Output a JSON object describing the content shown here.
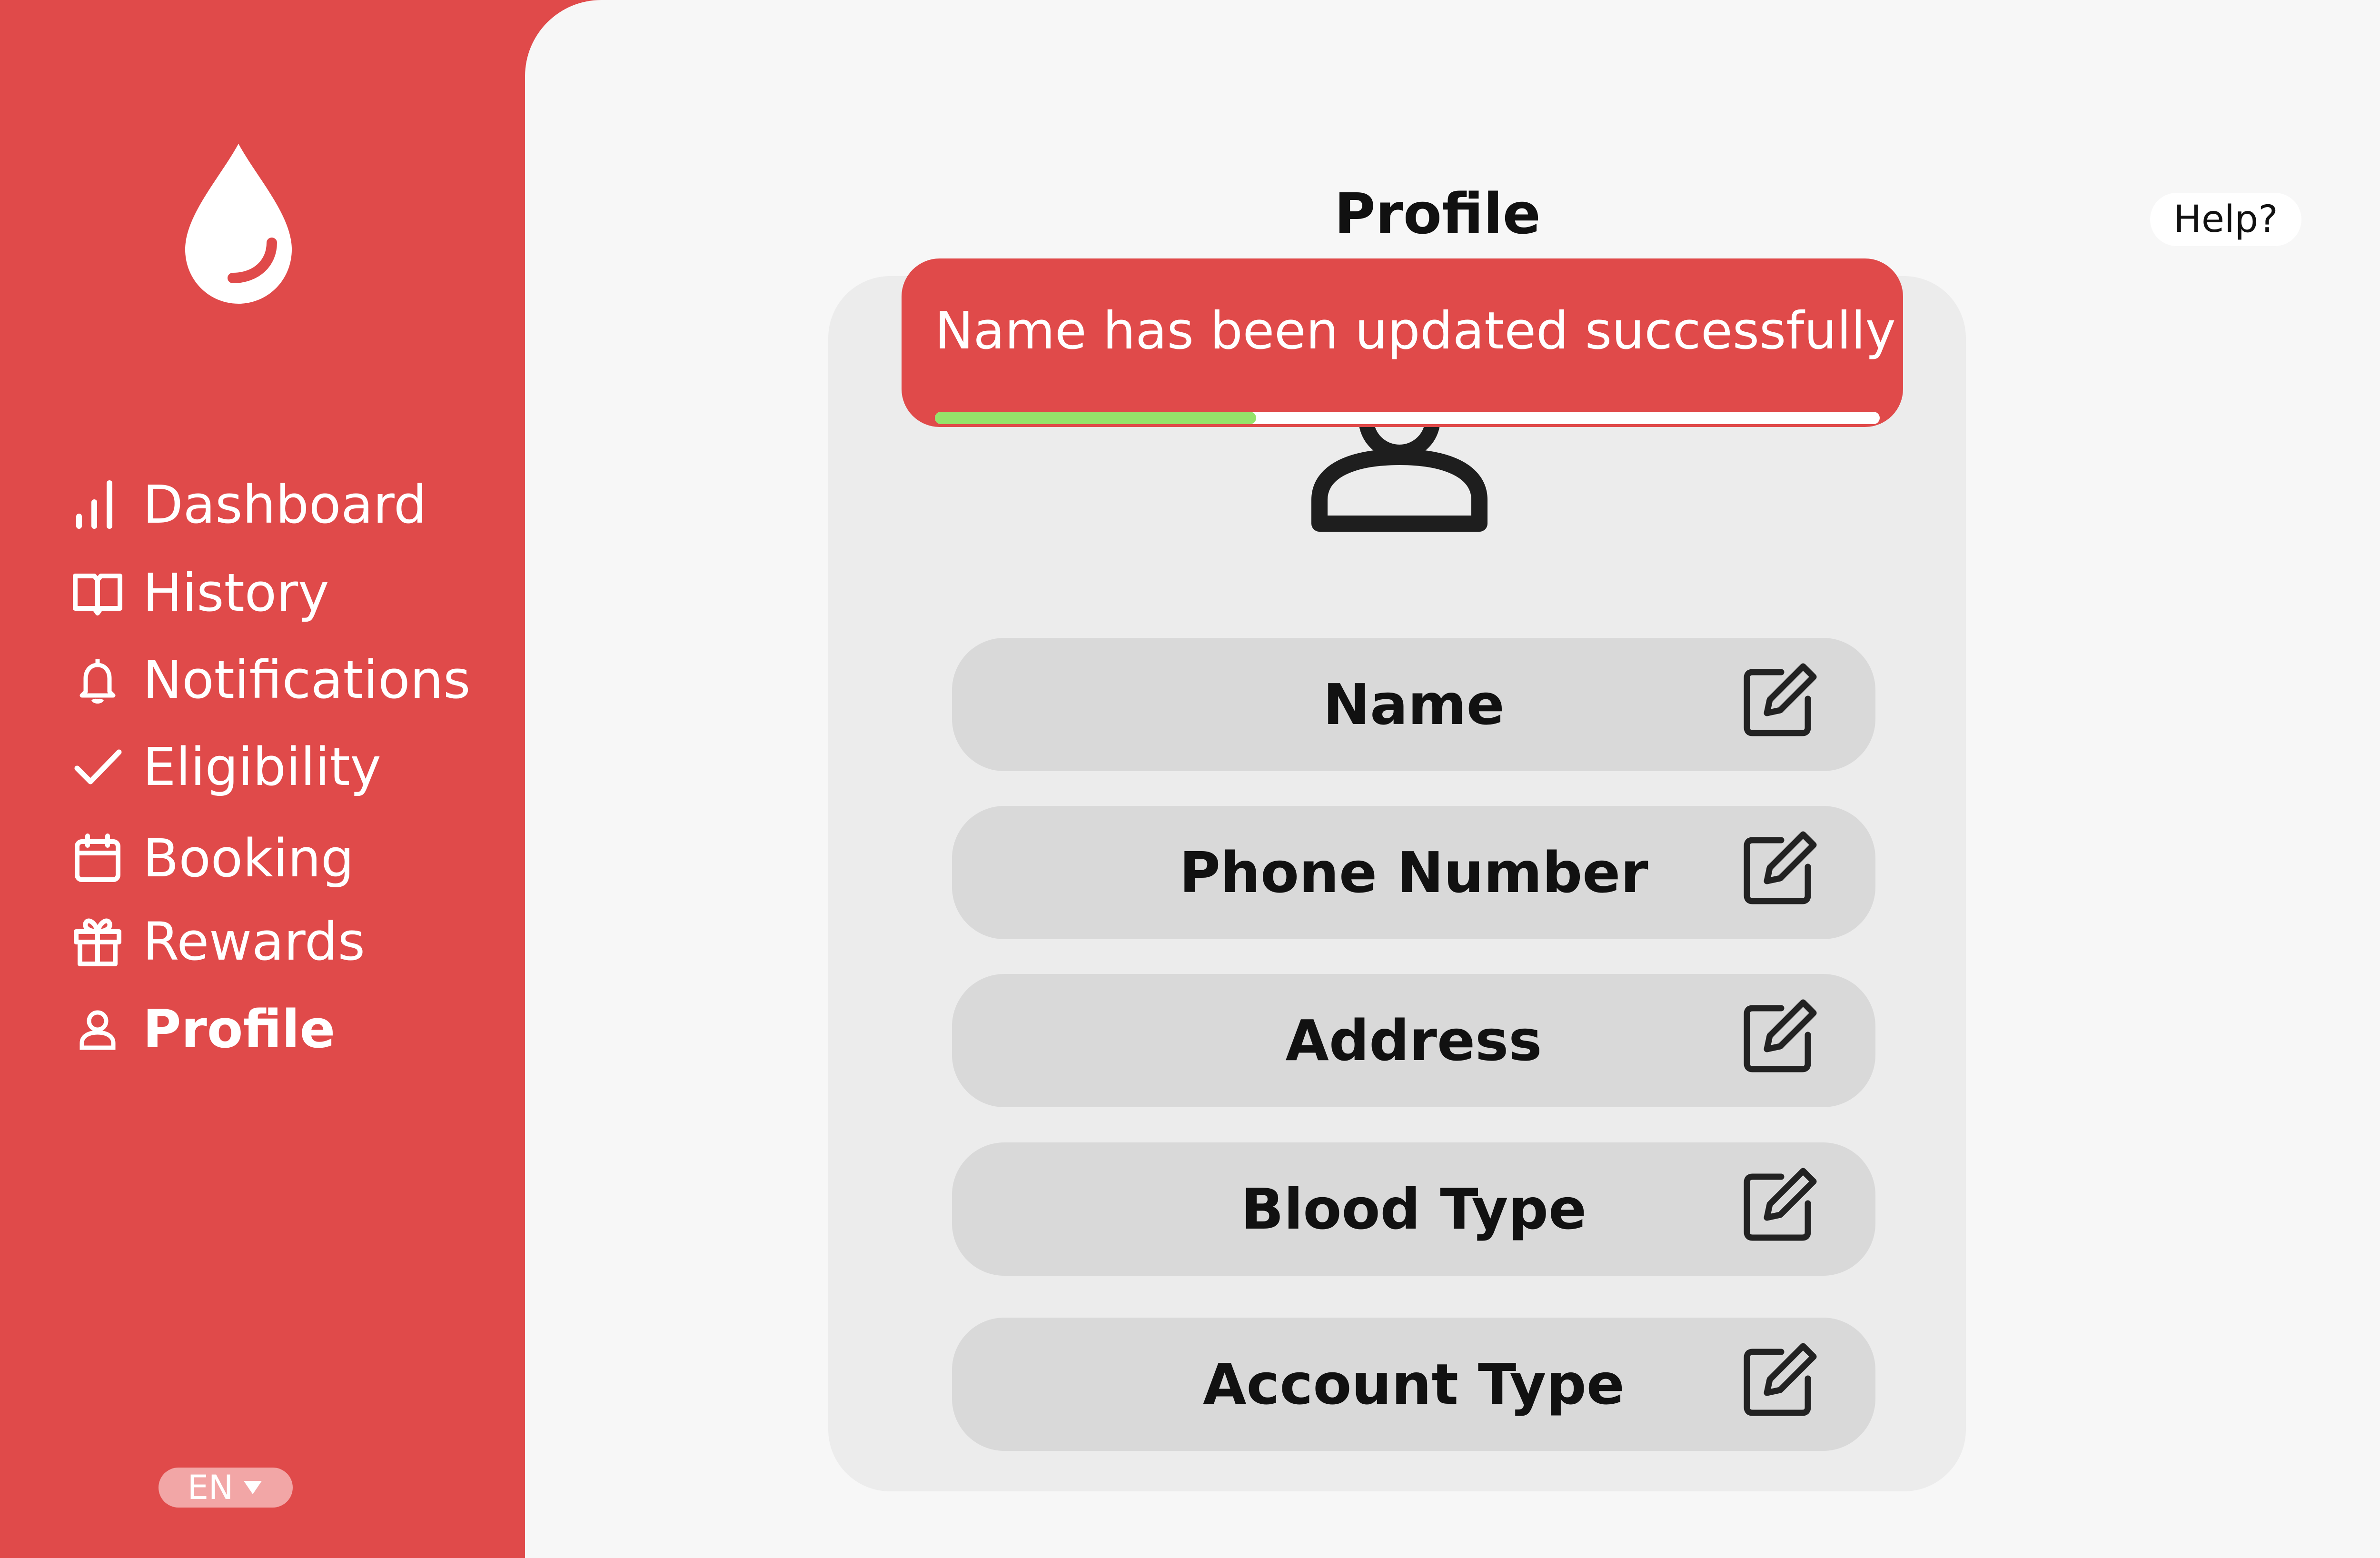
{
  "sidebar": {
    "logo_icon": "blood-drop-icon",
    "items": [
      {
        "label": "Dashboard",
        "icon": "bar-chart-icon",
        "active": false
      },
      {
        "label": "History",
        "icon": "book-icon",
        "active": false
      },
      {
        "label": "Notifications",
        "icon": "bell-icon",
        "active": false
      },
      {
        "label": "Eligibility",
        "icon": "check-icon",
        "active": false
      },
      {
        "label": "Booking",
        "icon": "calendar-icon",
        "active": false
      },
      {
        "label": "Rewards",
        "icon": "gift-icon",
        "active": false
      },
      {
        "label": "Profile",
        "icon": "user-icon",
        "active": true
      }
    ],
    "language": {
      "label": "EN",
      "icon": "caret-down-icon"
    }
  },
  "header": {
    "title": "Profile",
    "help_label": "Help?"
  },
  "toast": {
    "message": "Name has been updated successfully",
    "progress": 0.34,
    "progress_color": "#95e36a"
  },
  "profile": {
    "avatar_icon": "user-avatar-icon",
    "fields": [
      {
        "label": "Name",
        "icon": "edit-icon"
      },
      {
        "label": "Phone Number",
        "icon": "edit-icon"
      },
      {
        "label": "Address",
        "icon": "edit-icon"
      },
      {
        "label": "Blood Type",
        "icon": "edit-icon"
      },
      {
        "label": "Account Type",
        "icon": "edit-icon"
      }
    ]
  },
  "colors": {
    "brand": "#e04a4a",
    "background": "#f7f7f7",
    "card": "#ececec",
    "field": "#d9d9d9",
    "text": "#111111"
  }
}
